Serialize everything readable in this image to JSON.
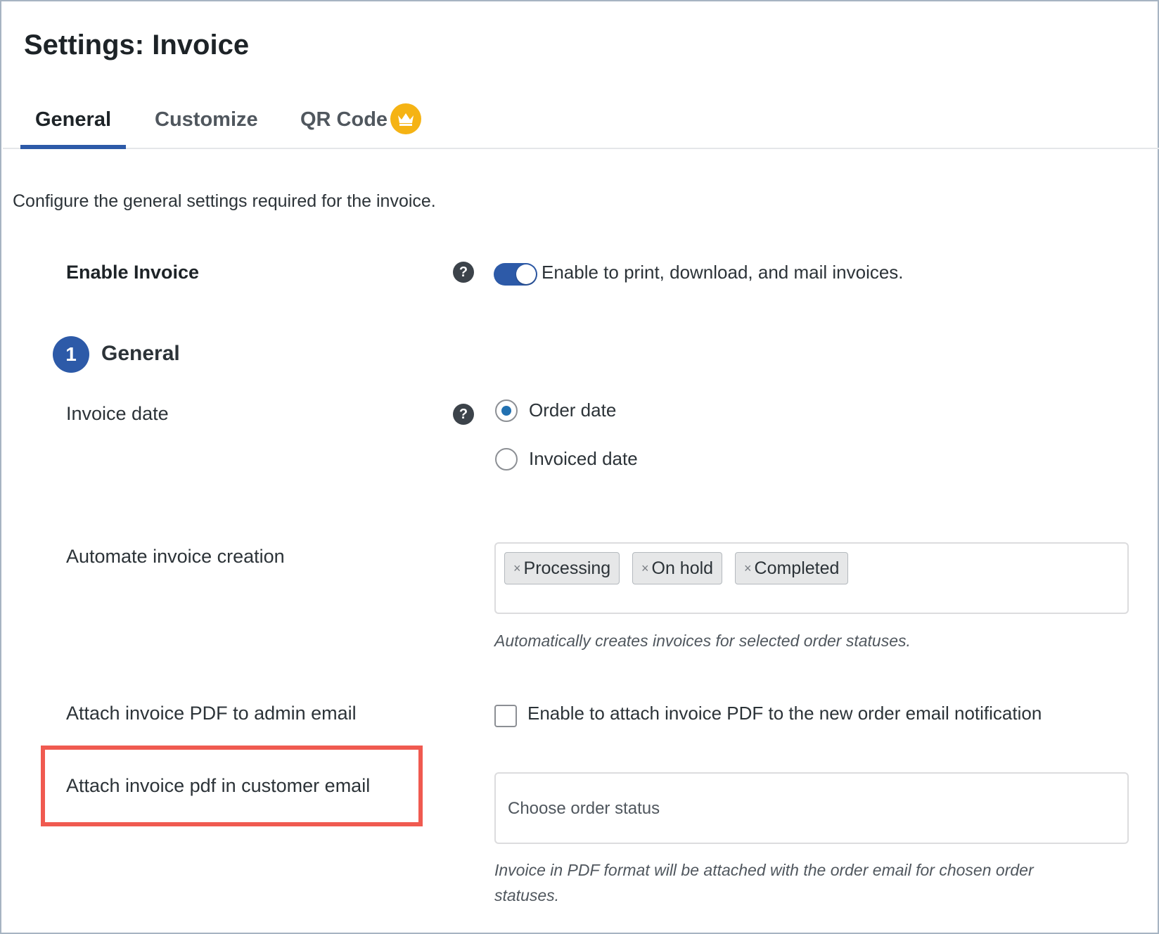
{
  "page": {
    "title": "Settings: Invoice"
  },
  "tabs": [
    {
      "label": "General",
      "active": true
    },
    {
      "label": "Customize",
      "active": false
    },
    {
      "label": "QR Code",
      "active": false,
      "badge_icon": "crown-icon"
    }
  ],
  "intro": "Configure the general settings required for the invoice.",
  "enable_invoice": {
    "label": "Enable Invoice",
    "toggle_on": true,
    "description": "Enable to print, download, and mail invoices."
  },
  "section": {
    "number": "1",
    "title": "General"
  },
  "invoice_date": {
    "label": "Invoice date",
    "options": [
      {
        "label": "Order date",
        "checked": true
      },
      {
        "label": "Invoiced date",
        "checked": false
      }
    ]
  },
  "automate": {
    "label": "Automate invoice creation",
    "selected": [
      "Processing",
      "On hold",
      "Completed"
    ],
    "hint": "Automatically creates invoices for selected order statuses."
  },
  "admin_email": {
    "label": "Attach invoice PDF to admin email",
    "checkbox_label": "Enable to attach invoice PDF to the new order email notification",
    "checked": false
  },
  "customer_email": {
    "label": "Attach invoice pdf in customer email",
    "placeholder": "Choose order status",
    "hint_line1": "Invoice in PDF format will be attached with the order email for chosen order",
    "hint_line2": "statuses."
  },
  "colors": {
    "accent": "#2d5aa8",
    "badge": "#f5b314",
    "highlight": "#f05a50"
  }
}
